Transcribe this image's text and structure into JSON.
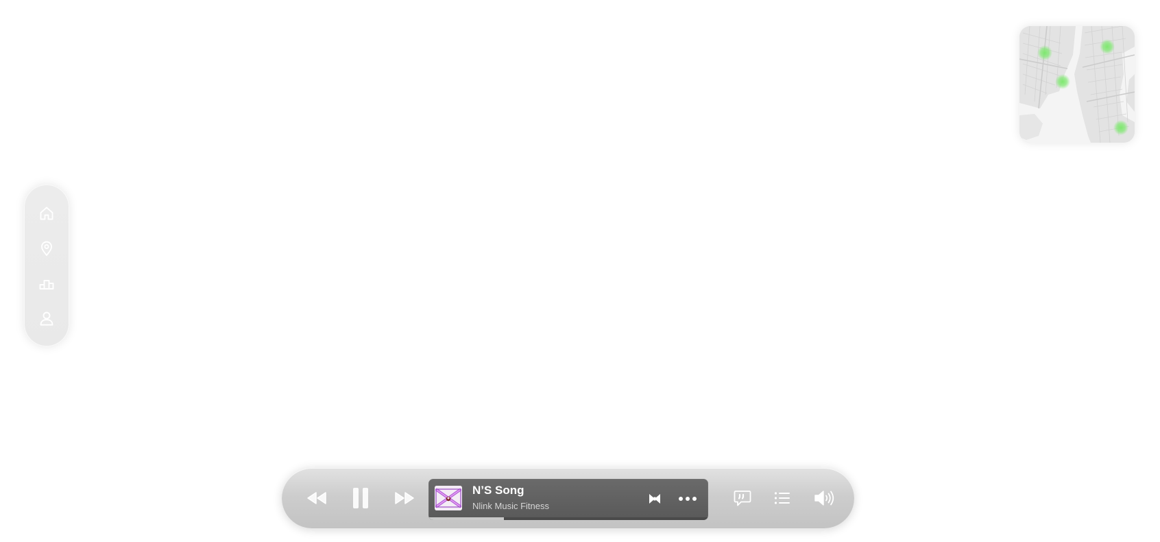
{
  "side_nav": {
    "items": [
      {
        "id": "home",
        "icon": "home-icon"
      },
      {
        "id": "location",
        "icon": "map-pin-icon"
      },
      {
        "id": "leaderboard",
        "icon": "podium-icon"
      },
      {
        "id": "profile",
        "icon": "user-icon"
      }
    ]
  },
  "minimap": {
    "marker_color": "#7ee86f",
    "markers": 4
  },
  "player": {
    "controls": {
      "rewind_icon": "rewind-icon",
      "pause_icon": "pause-icon",
      "forward_icon": "fast-forward-icon",
      "lyrics_icon": "lyrics-icon",
      "queue_icon": "queue-list-icon",
      "volume_icon": "volume-icon"
    },
    "track": {
      "title": "N’S Song",
      "artist": "Nlink Music Fitness",
      "progress": 0.27
    },
    "track_actions": {
      "mode_icon": "bowtie-icon",
      "more_icon": "more-icon"
    }
  }
}
